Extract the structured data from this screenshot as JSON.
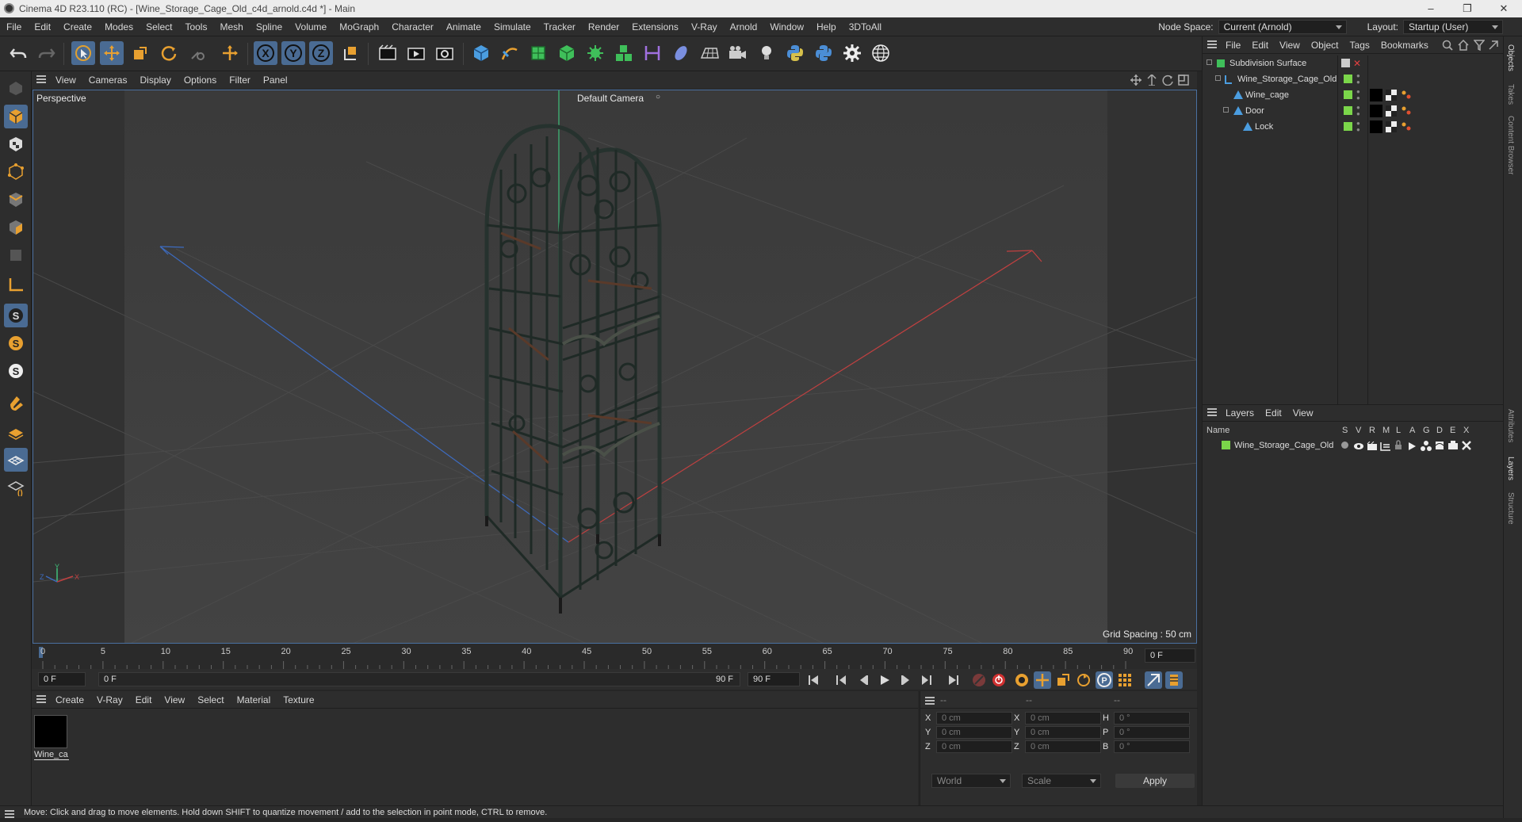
{
  "window": {
    "title": "Cinema 4D R23.110 (RC) - [Wine_Storage_Cage_Old_c4d_arnold.c4d *] - Main"
  },
  "menubar": {
    "items": [
      "File",
      "Edit",
      "Create",
      "Modes",
      "Select",
      "Tools",
      "Mesh",
      "Spline",
      "Volume",
      "MoGraph",
      "Character",
      "Animate",
      "Simulate",
      "Tracker",
      "Render",
      "Extensions",
      "V-Ray",
      "Arnold",
      "Window",
      "Help",
      "3DToAll"
    ],
    "node_space_label": "Node Space:",
    "node_space_value": "Current (Arnold)",
    "layout_label": "Layout:",
    "layout_value": "Startup (User)"
  },
  "viewport": {
    "menu": [
      "View",
      "Cameras",
      "Display",
      "Options",
      "Filter",
      "Panel"
    ],
    "name": "Perspective",
    "camera": "Default Camera",
    "grid_spacing": "Grid Spacing : 50 cm",
    "axis_labels": {
      "x": "X",
      "y": "Y",
      "z": "Z"
    }
  },
  "timeline": {
    "ticks": [
      "0",
      "5",
      "10",
      "15",
      "20",
      "25",
      "30",
      "35",
      "40",
      "45",
      "50",
      "55",
      "60",
      "65",
      "70",
      "75",
      "80",
      "85",
      "90"
    ],
    "current_frame": "0 F",
    "start_field": "0 F",
    "range_start": "0 F",
    "range_end": "90 F",
    "end_field": "90 F"
  },
  "material_manager": {
    "menu": [
      "Create",
      "V-Ray",
      "Edit",
      "View",
      "Select",
      "Material",
      "Texture"
    ],
    "materials": [
      {
        "name": "Wine_ca"
      }
    ]
  },
  "attributes": {
    "headers": [
      "--",
      "--",
      "--"
    ],
    "rows": [
      {
        "a_label": "X",
        "a_value": "0 cm",
        "b_label": "X",
        "b_value": "0 cm",
        "c_label": "H",
        "c_value": "0 °"
      },
      {
        "a_label": "Y",
        "a_value": "0 cm",
        "b_label": "Y",
        "b_value": "0 cm",
        "c_label": "P",
        "c_value": "0 °"
      },
      {
        "a_label": "Z",
        "a_value": "0 cm",
        "b_label": "Z",
        "b_value": "0 cm",
        "c_label": "B",
        "c_value": "0 °"
      }
    ],
    "coord_system": "World",
    "mode": "Scale",
    "apply_label": "Apply"
  },
  "object_manager": {
    "menu": [
      "File",
      "Edit",
      "View",
      "Object",
      "Tags",
      "Bookmarks"
    ],
    "objects": [
      {
        "name": "Subdivision Surface"
      },
      {
        "name": "Wine_Storage_Cage_Old"
      },
      {
        "name": "Wine_cage"
      },
      {
        "name": "Door"
      },
      {
        "name": "Lock"
      }
    ]
  },
  "layers_manager": {
    "menu": [
      "Layers",
      "Edit",
      "View"
    ],
    "columns": [
      "Name",
      "S",
      "V",
      "R",
      "M",
      "L",
      "A",
      "G",
      "D",
      "E",
      "X"
    ],
    "layers": [
      {
        "name": "Wine_Storage_Cage_Old",
        "color": "#7bd64a"
      }
    ]
  },
  "side_tabs": [
    "Objects",
    "Takes",
    "Content Browser",
    "Attributes",
    "Layers",
    "Structure"
  ],
  "status": "Move: Click and drag to move elements. Hold down SHIFT to quantize movement / add to the selection in point mode, CTRL to remove.",
  "colors": {
    "accent": "#4a6b93",
    "layer_green": "#7bd64a",
    "x_axis": "#c04040",
    "z_axis": "#3d6bbf",
    "y_axis": "#3fbf7a"
  }
}
